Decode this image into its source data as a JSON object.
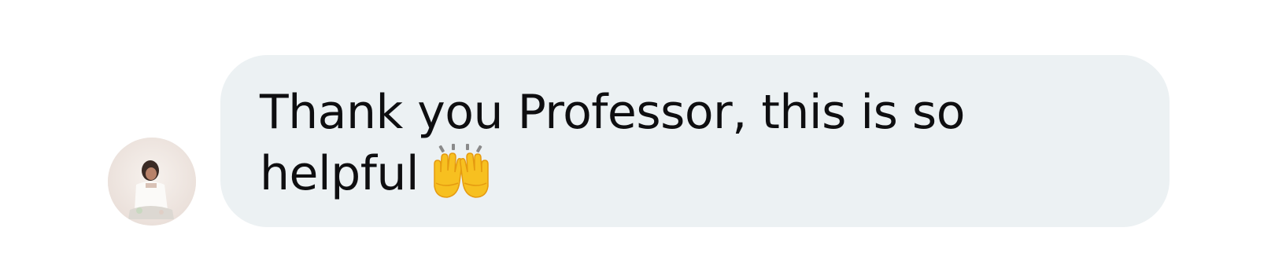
{
  "message": {
    "line1": "Thank you Professor, this is so",
    "line2": "helpful",
    "emoji_icon": "raising-hands-icon",
    "bubble_color": "#ecf1f3",
    "text_color": "#0e0e10"
  },
  "sender": {
    "avatar_icon": "user-avatar-photo"
  }
}
